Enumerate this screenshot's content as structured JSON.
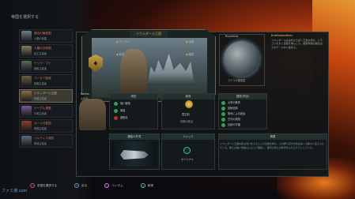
{
  "screen_title": "帝国を選択する",
  "species": [
    {
      "name": "連合の議長国",
      "sub": "人類の帝国",
      "color": "#6d7f8d"
    },
    {
      "name": "人類の共和国",
      "sub": "民主主義者",
      "color": "#8a7a64"
    },
    {
      "name": "テリラ・マナ",
      "sub": "調和主義者",
      "color": "#4f6d55"
    },
    {
      "name": "ユーゼア星域",
      "sub": "独裁主義者",
      "color": "#6b5d3e"
    },
    {
      "name": "イクシダール王国",
      "sub": "帝国主義者",
      "color": "#8f6b3a"
    },
    {
      "name": "ケーデル連盟",
      "sub": "平和主義者",
      "color": "#7a5a8a"
    },
    {
      "name": "カールガ星団",
      "sub": "軍国主義者",
      "color": "#8d3b2c"
    },
    {
      "name": "ソルディス帝国",
      "sub": "排他主義者",
      "color": "#5c6b7a"
    }
  ],
  "active_species_index": 4,
  "hero": {
    "title": "イクシダール王国",
    "tags": [
      "アイコン",
      "紋章",
      "出身",
      "種族"
    ]
  },
  "planet": {
    "title": "Ruvalina",
    "label": "ステラ大陸惑星"
  },
  "description": {
    "title": "Krahkasiedmer",
    "text": "イクシダールは古代から続く王政を持ち、ドラゴンの力と伝統を重んじる。星間帝国の誕生はそのゲーム中に始まる。"
  },
  "leader": {
    "name": "Forkis",
    "sub": "支配者"
  },
  "traits_card": {
    "title": "特性",
    "items": [
      {
        "label": "強い繁殖",
        "type": "green"
      },
      {
        "label": "頑強",
        "type": "green"
      },
      {
        "label": "遊牧民",
        "type": "red"
      }
    ]
  },
  "gov_card": {
    "title": "政府",
    "name": "君主制",
    "sub": "帝国の統治"
  },
  "civics_card": {
    "title": "国是(市民)",
    "items": [
      "大学の教育",
      "技術信仰",
      "祭司による統治",
      "古代の英知",
      "伝統の守護"
    ]
  },
  "ship_card": {
    "title": "艦船の外見"
  },
  "ethics_card": {
    "title": "エシック",
    "label": "オリジナル"
  },
  "about_card": {
    "title": "概要",
    "text": "イクシダール王国の民は竜に仕えるという伝説を持ち、その誇り高き文化は多くの星々に伝えられている。彼らは強い忠誠心によって団結し、銀河に新たな秩序をもたらそうとしている。"
  },
  "footer": [
    {
      "icon": "○",
      "label": "帝国を選択する",
      "style": "circle"
    },
    {
      "icon": "×",
      "label": "戻る",
      "style": "cross"
    },
    {
      "icon": "□",
      "label": "ランダム",
      "style": "square"
    },
    {
      "icon": "△",
      "label": "新規",
      "style": "triangle"
    }
  ],
  "watermark": "ファミ通.com"
}
